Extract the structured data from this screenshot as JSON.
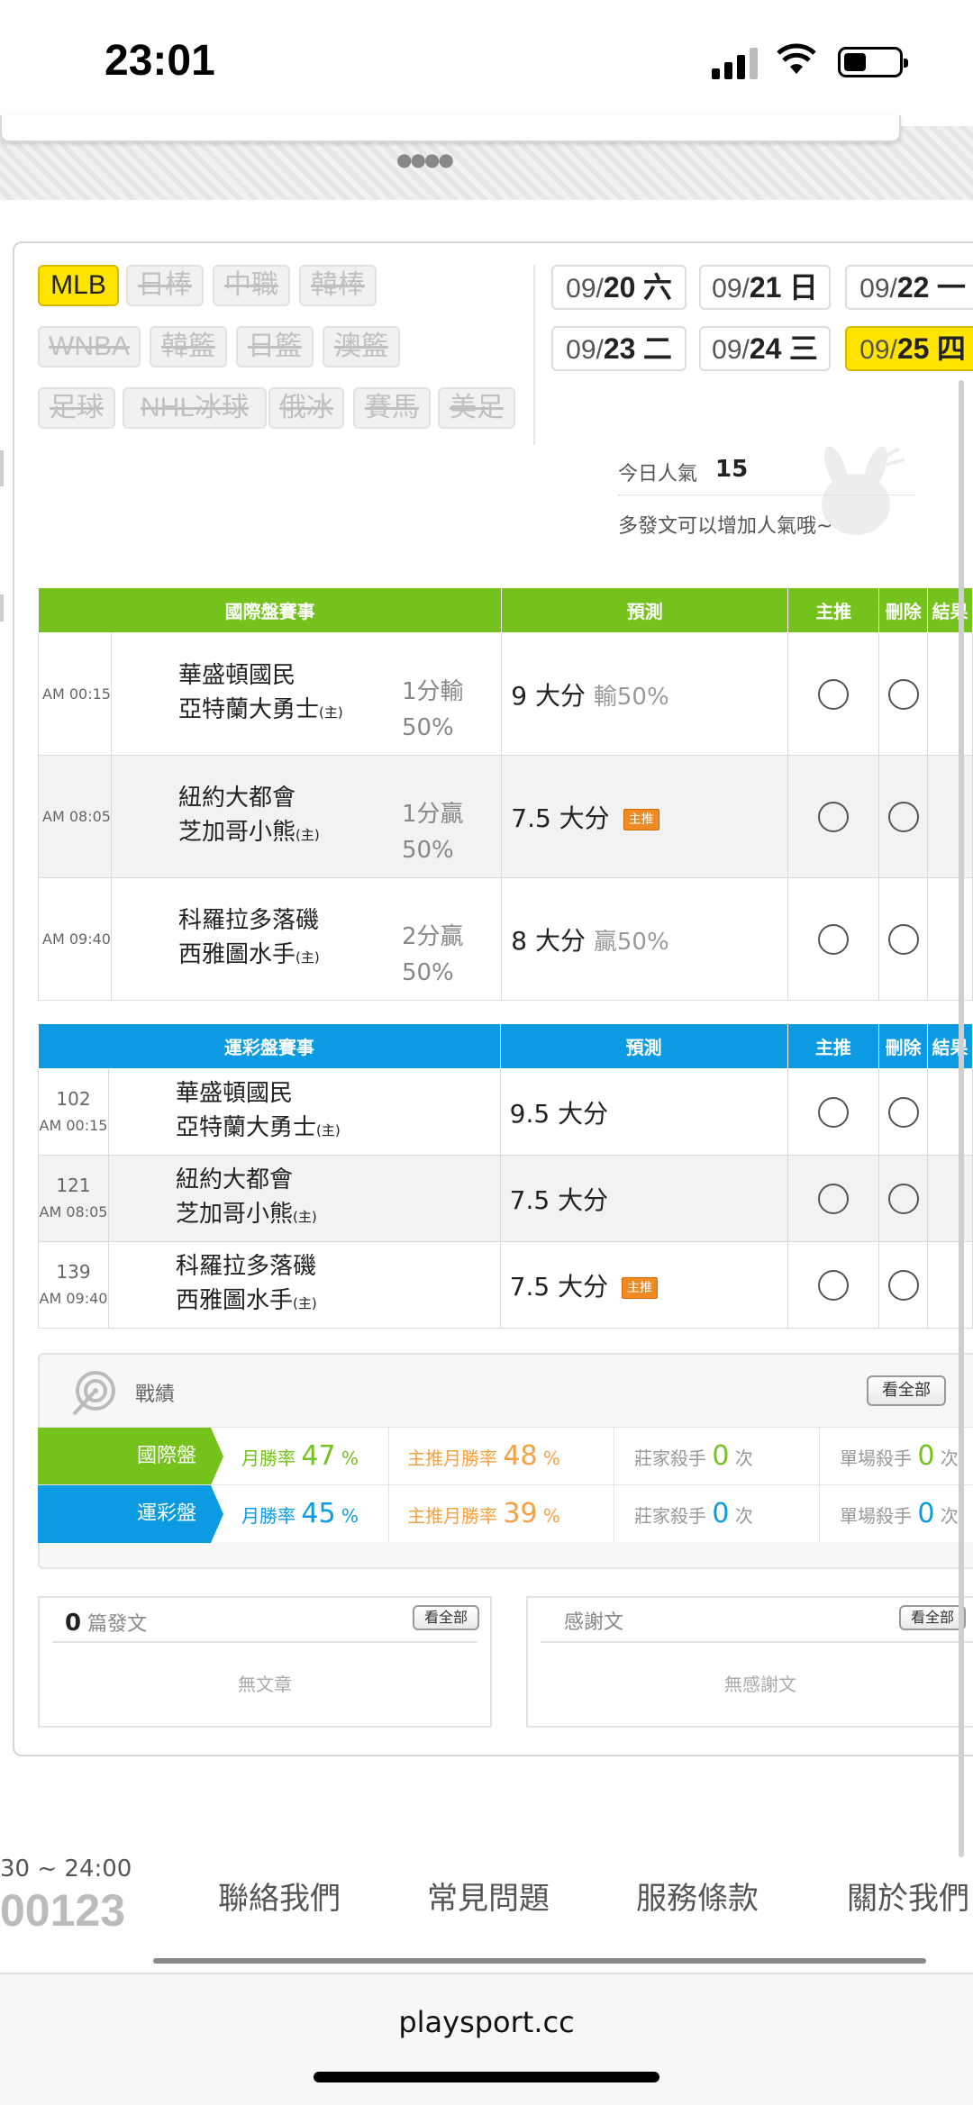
{
  "status_bar": {
    "time": "23:01"
  },
  "sport_tags": [
    "MLB",
    "日棒",
    "中職",
    "韓棒",
    "WNBA",
    "韓籃",
    "日籃",
    "澳籃",
    "足球",
    "NHL冰球",
    "俄冰",
    "賽馬",
    "美足"
  ],
  "dates": [
    {
      "md": "09/",
      "day": "20",
      "wd": "六"
    },
    {
      "md": "09/",
      "day": "21",
      "wd": "日"
    },
    {
      "md": "09/",
      "day": "22",
      "wd": "一"
    },
    {
      "md": "09/",
      "day": "23",
      "wd": "二"
    },
    {
      "md": "09/",
      "day": "24",
      "wd": "三"
    },
    {
      "md": "09/",
      "day": "25",
      "wd": "四"
    }
  ],
  "popularity": {
    "label": "今日人氣",
    "value": "15",
    "hint": "多發文可以增加人氣哦~"
  },
  "intl_table": {
    "headers": [
      "國際盤賽事",
      "預測",
      "主推",
      "刪除",
      "結果"
    ],
    "rows": [
      {
        "time": "AM 00:15",
        "away": "華盛頓國民",
        "home": "亞特蘭大勇士",
        "host": "(主)",
        "odds1": "1分輸",
        "odds2": "50%",
        "pred": "9 大分",
        "result": "輸50%",
        "badge": ""
      },
      {
        "time": "AM 08:05",
        "away": "紐約大都會",
        "home": "芝加哥小熊",
        "host": "(主)",
        "odds1": "1分贏",
        "odds2": "50%",
        "pred": "7.5 大分",
        "result": "",
        "badge": "主推"
      },
      {
        "time": "AM 09:40",
        "away": "科羅拉多落磯",
        "home": "西雅圖水手",
        "host": "(主)",
        "odds1": "2分贏",
        "odds2": "50%",
        "pred": "8 大分",
        "result": "贏50%",
        "badge": ""
      }
    ]
  },
  "lottery_table": {
    "headers": [
      "運彩盤賽事",
      "預測",
      "主推",
      "刪除",
      "結果"
    ],
    "rows": [
      {
        "num": "102",
        "time": "AM 00:15",
        "away": "華盛頓國民",
        "home": "亞特蘭大勇士",
        "host": "(主)",
        "pred": "9.5 大分",
        "badge": ""
      },
      {
        "num": "121",
        "time": "AM 08:05",
        "away": "紐約大都會",
        "home": "芝加哥小熊",
        "host": "(主)",
        "pred": "7.5 大分",
        "badge": ""
      },
      {
        "num": "139",
        "time": "AM 09:40",
        "away": "科羅拉多落磯",
        "home": "西雅圖水手",
        "host": "(主)",
        "pred": "7.5 大分",
        "badge": "主推"
      }
    ]
  },
  "record": {
    "title": "戰績",
    "see_all": "看全部",
    "rows": [
      {
        "label": "國際盤",
        "color": "#74c21b",
        "month_label": "月勝率",
        "month_val": "47",
        "pick_label": "主推月勝率",
        "pick_val": "48",
        "pct": "%",
        "house_label": "莊家殺手",
        "house_val": "0",
        "single_label": "單場殺手",
        "single_val": "0",
        "times": "次"
      },
      {
        "label": "運彩盤",
        "color": "#0c9be2",
        "month_label": "月勝率",
        "month_val": "45",
        "pick_label": "主推月勝率",
        "pick_val": "39",
        "pct": "%",
        "house_label": "莊家殺手",
        "house_val": "0",
        "single_label": "單場殺手",
        "single_val": "0",
        "times": "次"
      }
    ]
  },
  "posts": {
    "count": "0",
    "label": "篇發文",
    "see_all": "看全部",
    "empty": "無文章"
  },
  "thanks": {
    "label": "感謝文",
    "see_all": "看全部",
    "empty": "無感謝文"
  },
  "footer": {
    "hours": "30 ~ 24:00",
    "phone": "00123",
    "links": [
      "聯絡我們",
      "常見問題",
      "服務條款",
      "關於我們"
    ]
  },
  "browser": {
    "url": "playsport.cc"
  }
}
